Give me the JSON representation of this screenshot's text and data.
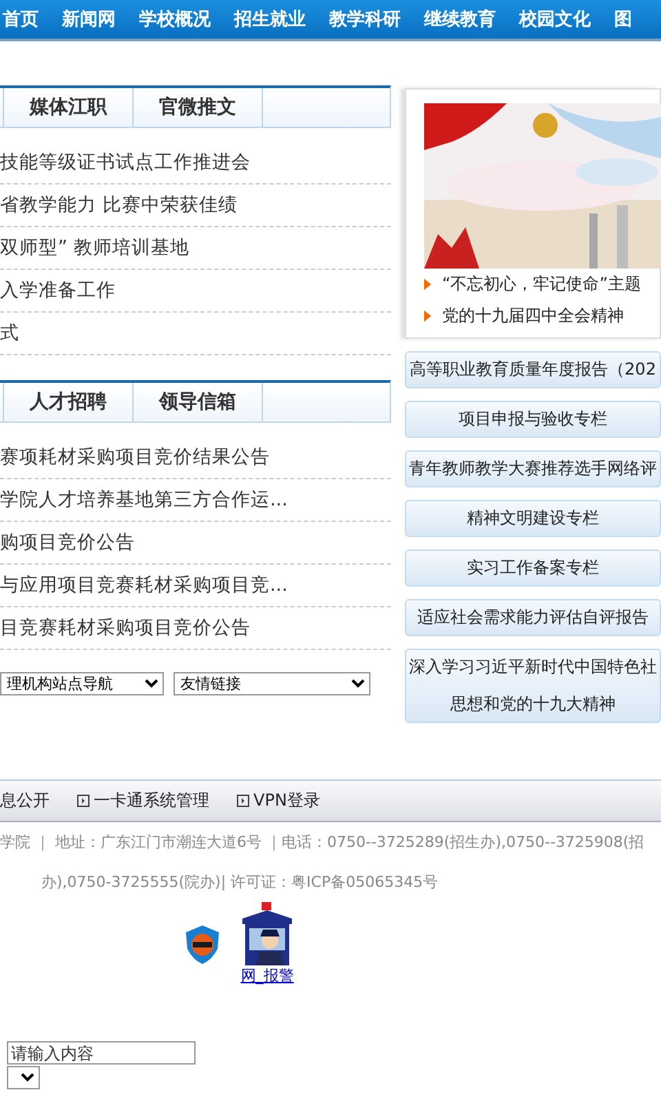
{
  "nav": {
    "items": [
      "首页",
      "新闻网",
      "学校概况",
      "招生就业",
      "教学科研",
      "继续教育",
      "校园文化",
      "图"
    ]
  },
  "news": {
    "tabs": [
      "媒体江职",
      "官微推文"
    ],
    "items": [
      "技能等级证书试点工作推进会",
      "省教学能力 比赛中荣获佳绩",
      "双师型” 教师培训基地",
      "入学准备工作",
      "式"
    ]
  },
  "notices": {
    "tabs": [
      "人才招聘",
      "领导信箱"
    ],
    "items": [
      "赛项耗材采购项目竞价结果公告",
      "学院人才培养基地第三方合作运...",
      "购项目竞价公告",
      "与应用项目竞赛耗材采购项目竞...",
      "目竞赛耗材采购项目竞价公告"
    ]
  },
  "selects": [
    "理机构站点导航",
    "友情链接"
  ],
  "feature": {
    "image": {
      "kind": "picture"
    },
    "links": [
      "“不忘初心，牢记使命”主题",
      "党的十九届四中全会精神"
    ]
  },
  "columns": [
    [
      "高等职业教育质量年度报告（202"
    ],
    [
      "项目申报与验收专栏"
    ],
    [
      "青年教师教学大赛推荐选手网络评"
    ],
    [
      "精神文明建设专栏"
    ],
    [
      "实习工作备案专栏"
    ],
    [
      "适应社会需求能力评估自评报告"
    ],
    [
      "深入学习习近平新时代中国特色社",
      "思想和党的十九大精神"
    ]
  ],
  "footer_links": [
    "息公开",
    "一卡通系统管理",
    "VPN登录"
  ],
  "address": [
    "学院 ｜ 地址：广东江门市潮连大道6号 ｜电话：0750--3725289(招生办),0750--3725908(招",
    "办),0750-3725555(院办)| 许可证：粤ICP备05065345号"
  ],
  "report_link": "网_报警",
  "search": {
    "placeholder": "请输入内容"
  }
}
